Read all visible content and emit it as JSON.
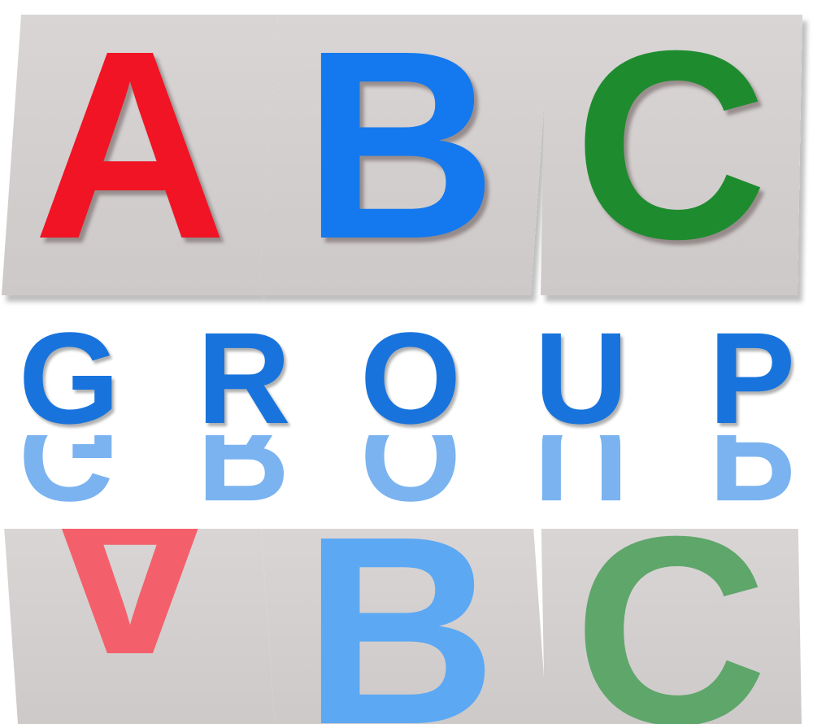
{
  "logo": {
    "tiles": [
      {
        "letter": "A",
        "color": "#f01424"
      },
      {
        "letter": "B",
        "color": "#1479ee"
      },
      {
        "letter": "C",
        "color": "#1e8c2e"
      }
    ],
    "word": [
      "G",
      "R",
      "O",
      "U",
      "P"
    ],
    "word_color": "#1874dc",
    "reflection": {
      "tiles": [
        "A",
        "B",
        "C"
      ],
      "word": [
        "G",
        "R",
        "O",
        "U",
        "P"
      ]
    }
  }
}
